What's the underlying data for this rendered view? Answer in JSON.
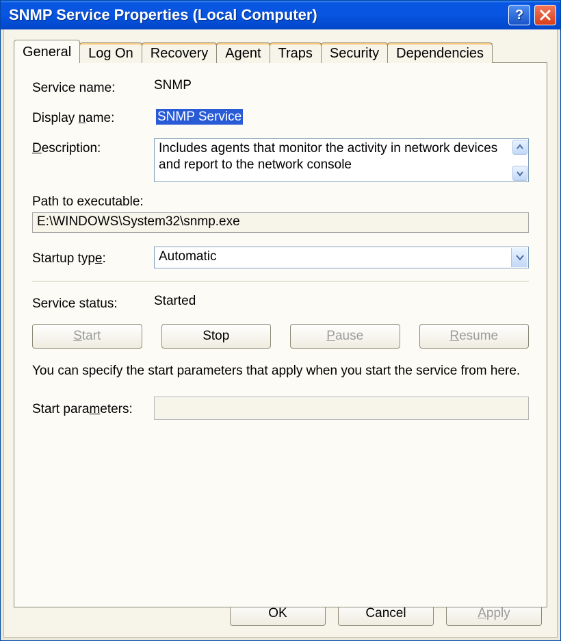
{
  "window": {
    "title": "SNMP Service Properties (Local Computer)"
  },
  "tabs": [
    "General",
    "Log On",
    "Recovery",
    "Agent",
    "Traps",
    "Security",
    "Dependencies"
  ],
  "active_tab": 0,
  "general": {
    "labels": {
      "service_name": "Service name:",
      "display_name_pre": "Display ",
      "display_name_u": "n",
      "display_name_post": "ame:",
      "description_u": "D",
      "description_post": "escription:",
      "path_label": "Path to executable:",
      "startup_type_pre": "Startup typ",
      "startup_type_u": "e",
      "startup_type_post": ":",
      "service_status": "Service status:",
      "start_params_pre": "Start para",
      "start_params_u": "m",
      "start_params_post": "eters:"
    },
    "service_name": "SNMP",
    "display_name": "SNMP Service",
    "description": "Includes agents that monitor the activity in network devices and report to the network console",
    "path": "E:\\WINDOWS\\System32\\snmp.exe",
    "startup_type": "Automatic",
    "status": "Started",
    "hint": "You can specify the start parameters that apply when you start the service from here.",
    "start_parameters": ""
  },
  "buttons": {
    "start_u": "S",
    "start_rest": "tart",
    "stop": "Stop",
    "pause_u": "P",
    "pause_rest": "ause",
    "resume_u": "R",
    "resume_rest": "esume",
    "ok": "OK",
    "cancel": "Cancel",
    "apply_u": "A",
    "apply_rest": "pply"
  }
}
